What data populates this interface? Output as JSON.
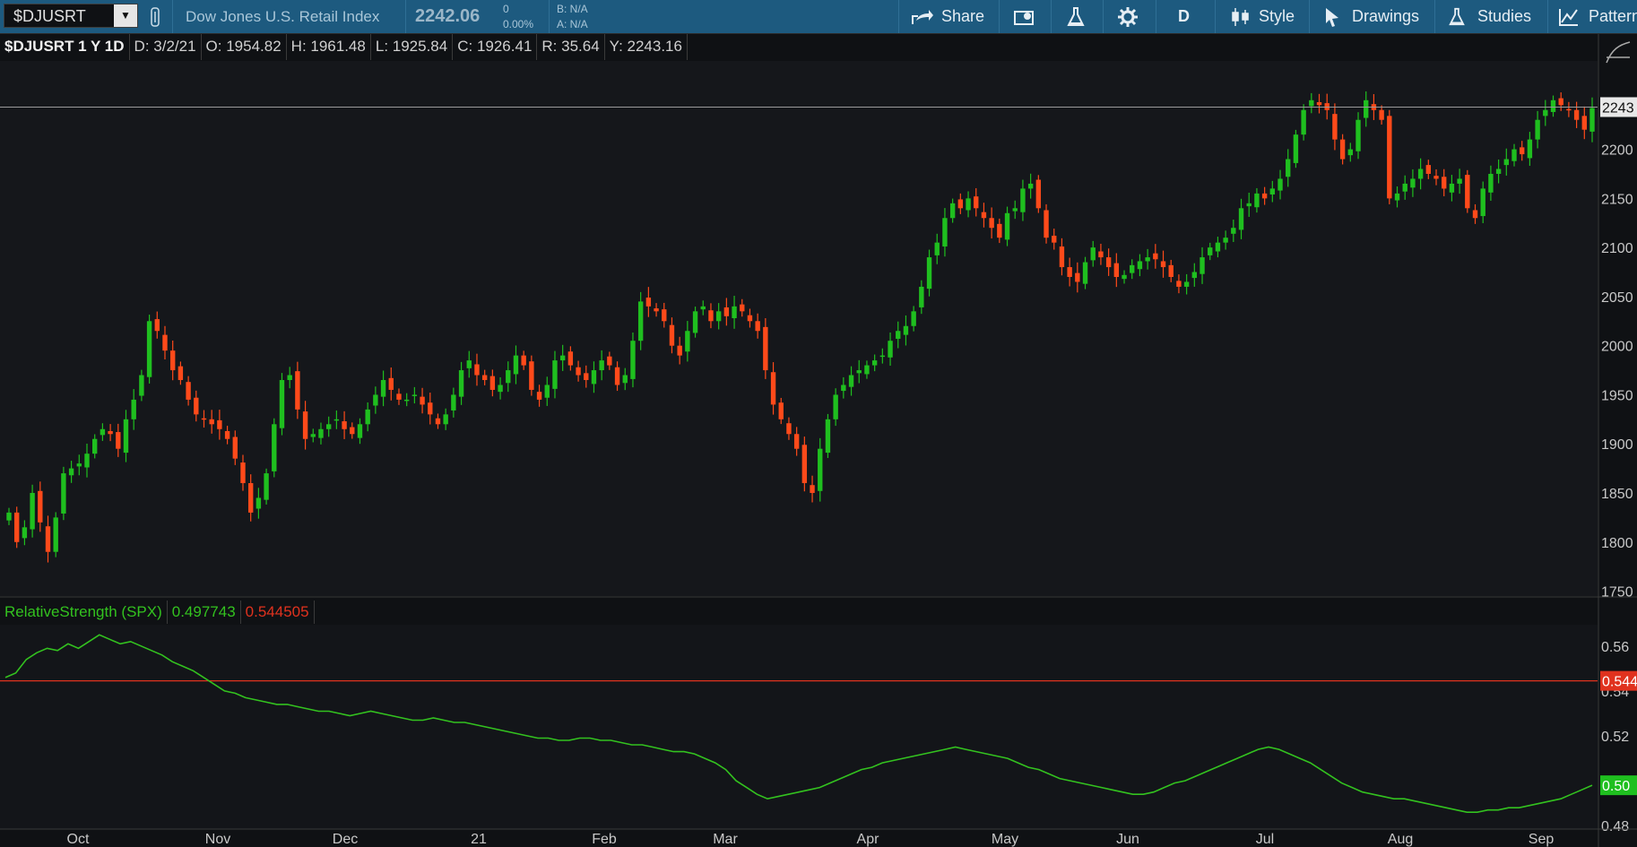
{
  "toolbar": {
    "symbol": "$DJUSRT",
    "index_name": "Dow Jones U.S. Retail Index",
    "last_price": "2242.06",
    "change": "0",
    "change_pct": "0.00%",
    "bid": "B: N/A",
    "ask": "A: N/A",
    "share_label": "Share",
    "aggregation_label": "D",
    "style_label": "Style",
    "drawings_label": "Drawings",
    "studies_label": "Studies",
    "patterns_label": "Pattern"
  },
  "ohlc_header": {
    "title": "$DJUSRT 1 Y 1D",
    "date": "D: 3/2/21",
    "open": "O: 1954.82",
    "high": "H: 1961.48",
    "low": "L: 1925.84",
    "close": "C: 1926.41",
    "range": "R: 35.64",
    "y": "Y: 2243.16"
  },
  "study_header": {
    "name": "RelativeStrength (SPX)",
    "value1": "0.497743",
    "value2": "0.544505"
  },
  "colors": {
    "background": "#0f1114",
    "up": "#1fbf1f",
    "down": "#ff4a1a",
    "toolbar": "#1d5a7f",
    "rs_line": "#33c21f",
    "ref_line": "#e0321e"
  },
  "chart_data": [
    {
      "type": "candlestick",
      "title": "$DJUSRT 1 Y 1D",
      "y_ticks": [
        1750,
        1800,
        1850,
        1900,
        1950,
        2000,
        2050,
        2100,
        2150,
        2200
      ],
      "ylim": [
        1745,
        2290
      ],
      "x_ticks": [
        "Oct",
        "Nov",
        "Dec",
        "21",
        "Feb",
        "Mar",
        "Apr",
        "May",
        "Jun",
        "Jul",
        "Aug",
        "Sep"
      ],
      "last_price_label": "2243",
      "last_price": 2243,
      "close_series": [
        1830,
        1800,
        1815,
        1850,
        1820,
        1790,
        1825,
        1870,
        1875,
        1880,
        1890,
        1905,
        1915,
        1910,
        1895,
        1925,
        1945,
        1970,
        2025,
        2015,
        1995,
        1975,
        1965,
        1945,
        1930,
        1925,
        1920,
        1915,
        1905,
        1885,
        1860,
        1830,
        1845,
        1870,
        1920,
        1965,
        1970,
        1935,
        1905,
        1910,
        1915,
        1920,
        1925,
        1915,
        1910,
        1920,
        1935,
        1950,
        1965,
        1955,
        1945,
        1945,
        1950,
        1940,
        1930,
        1920,
        1930,
        1950,
        1975,
        1985,
        1970,
        1965,
        1955,
        1960,
        1975,
        1990,
        1980,
        1955,
        1945,
        1960,
        1985,
        1990,
        1980,
        1970,
        1965,
        1975,
        1985,
        1980,
        1960,
        1970,
        2005,
        2045,
        2040,
        2035,
        2025,
        2000,
        1990,
        2015,
        2035,
        2040,
        2025,
        2035,
        2030,
        2040,
        2035,
        2025,
        2015,
        1975,
        1940,
        1925,
        1910,
        1895,
        1860,
        1850,
        1895,
        1925,
        1950,
        1960,
        1970,
        1975,
        1980,
        1985,
        1990,
        2005,
        2015,
        2020,
        2035,
        2060,
        2090,
        2105,
        2130,
        2145,
        2140,
        2150,
        2140,
        2130,
        2120,
        2110,
        2135,
        2140,
        2160,
        2165,
        2140,
        2110,
        2105,
        2080,
        2070,
        2065,
        2085,
        2100,
        2090,
        2080,
        2070,
        2072,
        2082,
        2086,
        2090,
        2088,
        2080,
        2070,
        2060,
        2065,
        2075,
        2090,
        2100,
        2105,
        2110,
        2120,
        2140,
        2145,
        2155,
        2150,
        2160,
        2170,
        2190,
        2215,
        2240,
        2250,
        2245,
        2240,
        2210,
        2190,
        2200,
        2230,
        2250,
        2240,
        2230,
        2150,
        2155,
        2165,
        2170,
        2180,
        2175,
        2170,
        2160,
        2165,
        2170,
        2140,
        2130,
        2160,
        2175,
        2180,
        2190,
        2200,
        2195,
        2210,
        2230,
        2240,
        2250,
        2245,
        2240,
        2230,
        2220,
        2242
      ]
    },
    {
      "type": "line",
      "title": "RelativeStrength (SPX)",
      "y_ticks": [
        0.48,
        0.5,
        0.52,
        0.54,
        0.56
      ],
      "ylim": [
        0.4785,
        0.5695
      ],
      "ref_value": 0.544505,
      "ref_label": "0.544",
      "last_label": "0.50",
      "x_ticks": [
        "Oct",
        "Nov",
        "Dec",
        "21",
        "Feb",
        "Mar",
        "Apr",
        "May",
        "Jun",
        "Jul",
        "Aug",
        "Sep"
      ],
      "series": [
        {
          "values": [
            0.546,
            0.548,
            0.554,
            0.557,
            0.559,
            0.558,
            0.561,
            0.559,
            0.562,
            0.565,
            0.563,
            0.561,
            0.562,
            0.56,
            0.558,
            0.556,
            0.553,
            0.551,
            0.549,
            0.546,
            0.543,
            0.54,
            0.539,
            0.537,
            0.536,
            0.535,
            0.534,
            0.534,
            0.533,
            0.532,
            0.531,
            0.531,
            0.53,
            0.529,
            0.53,
            0.531,
            0.53,
            0.529,
            0.528,
            0.527,
            0.527,
            0.528,
            0.527,
            0.526,
            0.526,
            0.525,
            0.524,
            0.523,
            0.522,
            0.521,
            0.52,
            0.519,
            0.519,
            0.518,
            0.518,
            0.519,
            0.519,
            0.518,
            0.518,
            0.517,
            0.516,
            0.516,
            0.515,
            0.514,
            0.513,
            0.513,
            0.512,
            0.51,
            0.508,
            0.505,
            0.5,
            0.497,
            0.494,
            0.492,
            0.493,
            0.494,
            0.495,
            0.496,
            0.497,
            0.499,
            0.501,
            0.503,
            0.505,
            0.506,
            0.508,
            0.509,
            0.51,
            0.511,
            0.512,
            0.513,
            0.514,
            0.515,
            0.514,
            0.513,
            0.512,
            0.511,
            0.51,
            0.508,
            0.506,
            0.505,
            0.503,
            0.501,
            0.5,
            0.499,
            0.498,
            0.497,
            0.496,
            0.495,
            0.494,
            0.494,
            0.495,
            0.497,
            0.499,
            0.5,
            0.502,
            0.504,
            0.506,
            0.508,
            0.51,
            0.512,
            0.514,
            0.515,
            0.514,
            0.512,
            0.51,
            0.508,
            0.505,
            0.502,
            0.499,
            0.497,
            0.495,
            0.494,
            0.493,
            0.492,
            0.492,
            0.491,
            0.49,
            0.489,
            0.488,
            0.487,
            0.486,
            0.486,
            0.487,
            0.487,
            0.488,
            0.488,
            0.489,
            0.49,
            0.491,
            0.492,
            0.494,
            0.496,
            0.498
          ]
        }
      ]
    }
  ]
}
